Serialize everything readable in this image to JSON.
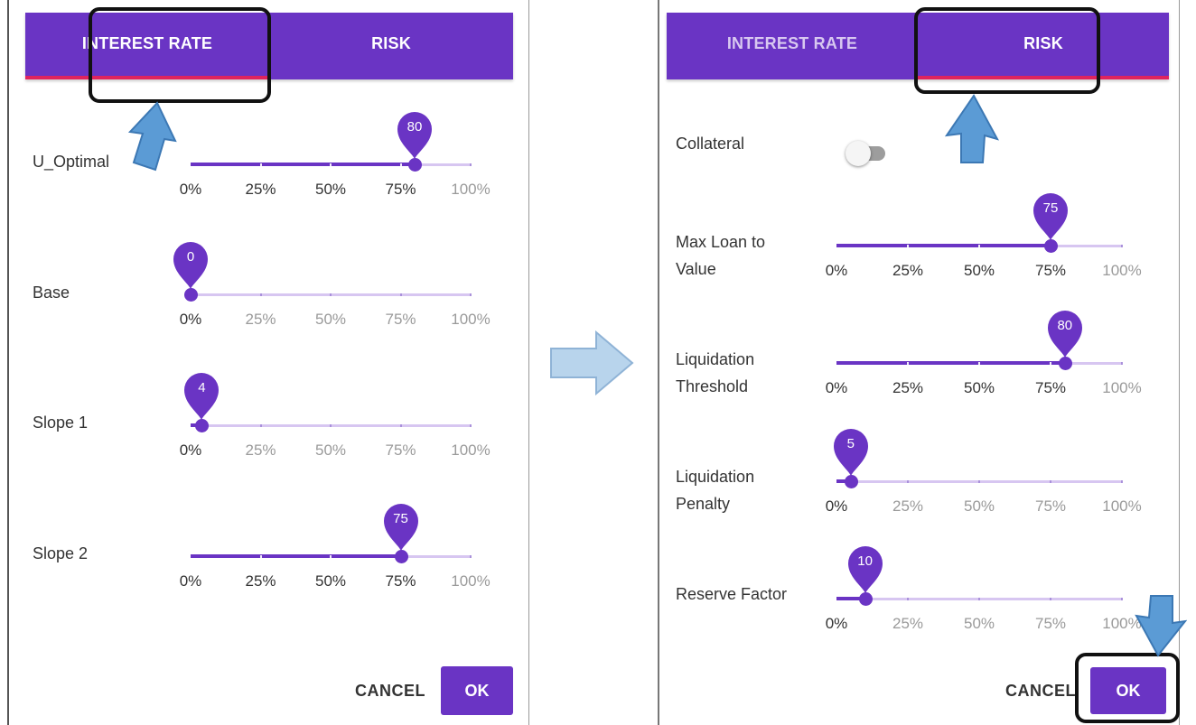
{
  "left": {
    "tabs": [
      {
        "label": "INTEREST RATE",
        "active": true
      },
      {
        "label": "RISK",
        "active": false
      }
    ],
    "sliders": [
      {
        "label": "U_Optimal",
        "value": 80
      },
      {
        "label": "Base",
        "value": 0
      },
      {
        "label": "Slope 1",
        "value": 4
      },
      {
        "label": "Slope 2",
        "value": 75
      }
    ],
    "tick_labels": [
      "0%",
      "25%",
      "50%",
      "75%",
      "100%"
    ],
    "cancel_label": "CANCEL",
    "ok_label": "OK"
  },
  "right": {
    "tabs": [
      {
        "label": "INTEREST RATE",
        "active": false
      },
      {
        "label": "RISK",
        "active": true
      }
    ],
    "collateral": {
      "label": "Collateral",
      "enabled": false
    },
    "sliders": [
      {
        "label": "Max Loan to Value",
        "label_lines": [
          "Max Loan to",
          "Value"
        ],
        "value": 75
      },
      {
        "label": "Liquidation Threshold",
        "label_lines": [
          "Liquidation",
          "Threshold"
        ],
        "value": 80
      },
      {
        "label": "Liquidation Penalty",
        "label_lines": [
          "Liquidation",
          "Penalty"
        ],
        "value": 5
      },
      {
        "label": "Reserve Factor",
        "label_lines": [
          "Reserve Factor"
        ],
        "value": 10
      }
    ],
    "tick_labels": [
      "0%",
      "25%",
      "50%",
      "75%",
      "100%"
    ],
    "cancel_label": "CANCEL",
    "ok_label": "OK"
  },
  "colors": {
    "accent": "#6a34c4",
    "tab_indicator": "#e0245e",
    "annotation_arrow": "#5b9bd5",
    "transition_arrow": "#b8d4ec"
  },
  "icons": {
    "annotation": "up-arrow-icon",
    "transition": "right-arrow-icon",
    "ok_pointer": "down-arrow-icon"
  }
}
